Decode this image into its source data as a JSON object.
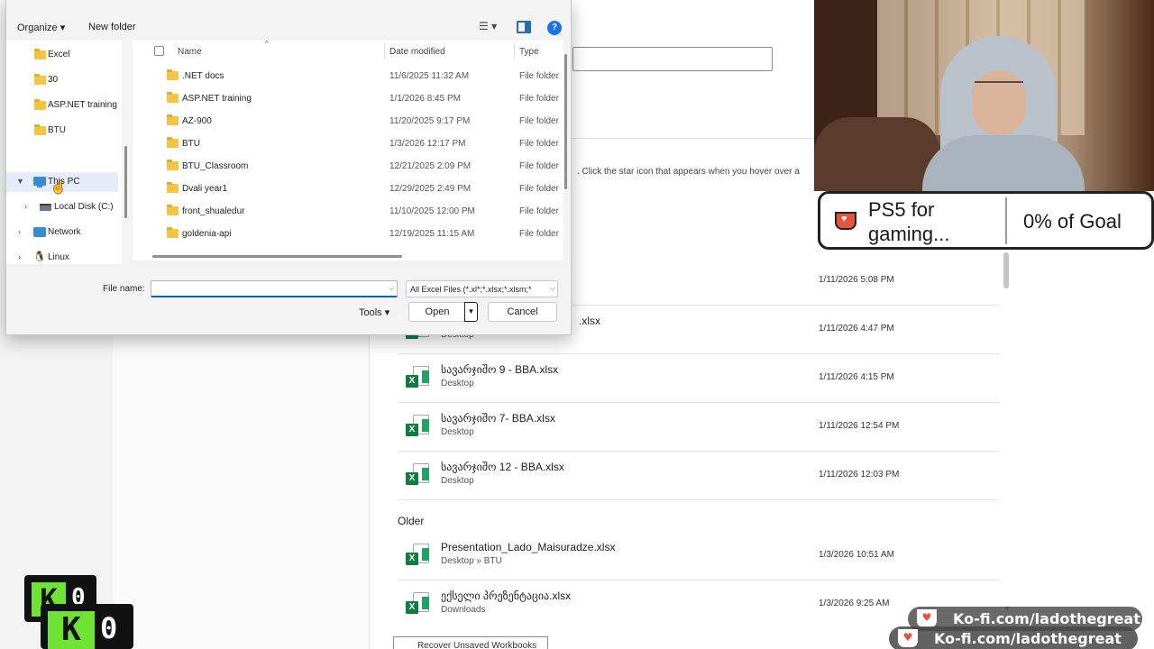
{
  "dialog": {
    "toolbar": {
      "organize": "Organize",
      "new_folder": "New folder",
      "help": "?"
    },
    "nav": [
      {
        "label": "Excel",
        "type": "folder"
      },
      {
        "label": "30",
        "type": "folder"
      },
      {
        "label": "ASP.NET training",
        "type": "folder"
      },
      {
        "label": "BTU",
        "type": "folder"
      },
      {
        "label": "This PC",
        "type": "pc"
      },
      {
        "label": "Local Disk (C:)",
        "type": "disk"
      },
      {
        "label": "Network",
        "type": "network"
      },
      {
        "label": "Linux",
        "type": "linux"
      }
    ],
    "columns": {
      "name": "Name",
      "date": "Date modified",
      "type": "Type"
    },
    "files": [
      {
        "name": ".NET docs",
        "date": "11/6/2025 11:32 AM",
        "type": "File folder"
      },
      {
        "name": "ASP.NET training",
        "date": "1/1/2026 8:45 PM",
        "type": "File folder"
      },
      {
        "name": "AZ-900",
        "date": "11/20/2025 9:17 PM",
        "type": "File folder"
      },
      {
        "name": "BTU",
        "date": "1/3/2026 12:17 PM",
        "type": "File folder"
      },
      {
        "name": "BTU_Classroom",
        "date": "12/21/2025 2:09 PM",
        "type": "File folder"
      },
      {
        "name": "Dvali year1",
        "date": "12/29/2025 2:49 PM",
        "type": "File folder"
      },
      {
        "name": "front_shualedur",
        "date": "11/10/2025 12:00 PM",
        "type": "File folder"
      },
      {
        "name": "goldenia-api",
        "date": "12/19/2025 11:15 AM",
        "type": "File folder"
      }
    ],
    "filename_label": "File name:",
    "filename_value": "",
    "filetype": "All Excel Files (*.xl*;*.xlsx;*.xlsm;*",
    "tools": "Tools",
    "open": "Open",
    "cancel": "Cancel"
  },
  "background": {
    "pin_tip": ". Click the star icon that appears when you hover over a",
    "recent": [
      {
        "name": "",
        "path": "",
        "date": "1/11/2026 5:08 PM"
      },
      {
        "name": ".xlsx",
        "path": "Desktop",
        "date": "1/11/2026 4:47 PM"
      },
      {
        "name": "სავარჯიშო 9 - BBA.xlsx",
        "path": "Desktop",
        "date": "1/11/2026 4:15 PM"
      },
      {
        "name": "სავარჯიშო 7- BBA.xlsx",
        "path": "Desktop",
        "date": "1/11/2026 12:54 PM"
      },
      {
        "name": "სავარჯიშო 12 - BBA.xlsx",
        "path": "Desktop",
        "date": "1/11/2026 12:03 PM"
      }
    ],
    "older_heading": "Older",
    "older": [
      {
        "name": "Presentation_Lado_Maisuradze.xlsx",
        "path": "Desktop » BTU",
        "date": "1/3/2026 10:51 AM"
      },
      {
        "name": "ექსელი პრეზენტაცია.xlsx",
        "path": "Downloads",
        "date": "1/3/2026 9:25 AM"
      }
    ],
    "recover_button": "Recover Unsaved Workbooks"
  },
  "overlay": {
    "goal": {
      "title": "PS5 for\ngaming...",
      "percent": "0% of Goal"
    },
    "kofi_counters": [
      "0",
      "0"
    ],
    "kofi_banner": "Ko-fi.com/ladothegreat"
  },
  "colors": {
    "excel_green": "#107c41",
    "kofi_green": "#6ee334",
    "accent_blue": "#0067c0"
  }
}
